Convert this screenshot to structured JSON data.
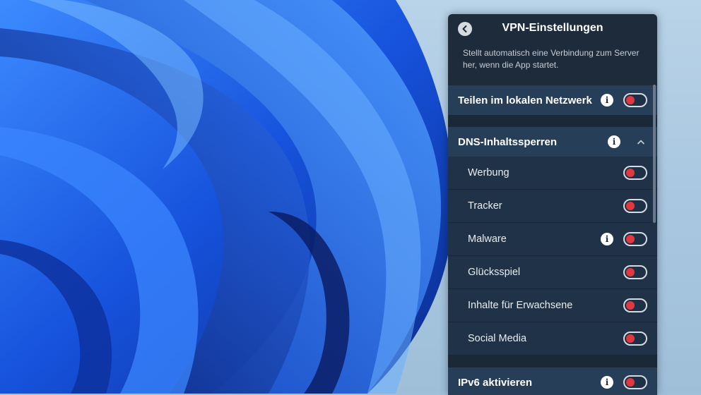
{
  "panel": {
    "title": "VPN-Einstellungen",
    "description": "Stellt automatisch eine Verbindung zum Server her, wenn die App startet.",
    "local_share": {
      "label": "Teilen im lokalen Netzwerk"
    },
    "dns": {
      "label": "DNS-Inhaltssperren",
      "items": [
        {
          "label": "Werbung"
        },
        {
          "label": "Tracker"
        },
        {
          "label": "Malware"
        },
        {
          "label": "Glücksspiel"
        },
        {
          "label": "Inhalte für Erwachsene"
        },
        {
          "label": "Social Media"
        }
      ]
    },
    "ipv6": {
      "label": "IPv6 aktivieren"
    },
    "info_glyph": "i"
  },
  "colors": {
    "toggle_knob": "#e0383e",
    "panel_bg": "#1d2b3b",
    "section_bg": "#263e58",
    "wallpaper_blue": "#1f5bd8"
  }
}
